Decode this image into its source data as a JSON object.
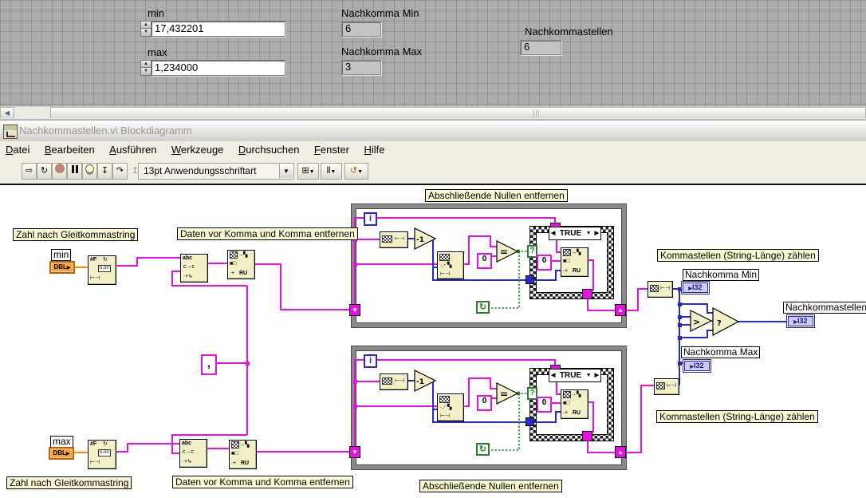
{
  "front_panel": {
    "min": {
      "label": "min",
      "value": "17,432201"
    },
    "max": {
      "label": "max",
      "value": "1,234000"
    },
    "nachkomma_min": {
      "label": "Nachkomma Min",
      "value": "6"
    },
    "nachkomma_max": {
      "label": "Nachkomma Max",
      "value": "3"
    },
    "nachkommastellen": {
      "label": "Nachkommastellen",
      "value": "6"
    }
  },
  "window": {
    "title": "Nachkommastellen.vi Blockdiagramm"
  },
  "menu": {
    "items": [
      "Datei",
      "Bearbeiten",
      "Ausführen",
      "Werkzeuge",
      "Durchsuchen",
      "Fenster",
      "Hilfe"
    ]
  },
  "toolbar": {
    "font_selector": "13pt Anwendungsschriftart",
    "run_icon": "⇨",
    "run_cont_icon": "↻",
    "step_into_icon": "↧",
    "step_over_icon": "↷",
    "step_out_icon": "↥",
    "dropdown_arrow": "▼",
    "align_icon": "⊞",
    "distribute_icon": "⫴",
    "reorder_icon": "↺"
  },
  "diagram": {
    "labels": {
      "zahl": "Zahl nach Gleitkommastring",
      "daten": "Daten vor Komma und Komma entfernen",
      "nullen": "Abschließende Nullen entfernen",
      "komma": "Kommastellen (String-Länge) zählen",
      "nachkomma_min": "Nachkomma Min",
      "nachkomma_max": "Nachkomma Max",
      "nachkommastellen": "Nachkommastellen",
      "min": "min",
      "max": "max"
    },
    "terminals": {
      "dbl": "DBL",
      "i32": "I32",
      "out_arrow": "▶"
    },
    "constants": {
      "zero": "0",
      "comma": ","
    },
    "case_structure": {
      "selector": "TRUE",
      "prev": "◀",
      "next": "▶",
      "drop": "▼"
    },
    "loop": {
      "iterator": "i",
      "condition": "↻",
      "selector_q": "?"
    },
    "ops": {
      "decrement": "-1",
      "equal": "=",
      "greater": ">",
      "select": "?"
    },
    "icons": {
      "format_1": "#F",
      "format_2": "↻",
      "format_3": "n.nn",
      "format_4": "⊢⊣",
      "match_1": "abc",
      "match_2": "c→c",
      "match_3": "∙+↳",
      "replace_1": "→▚",
      "replace_2": "■□",
      "replace_3": "∙+",
      "replace_ru": "RU",
      "length_1": "⊢⊣",
      "subset_1": "∙⋰▚",
      "subset_2": "⊢⊣"
    }
  }
}
